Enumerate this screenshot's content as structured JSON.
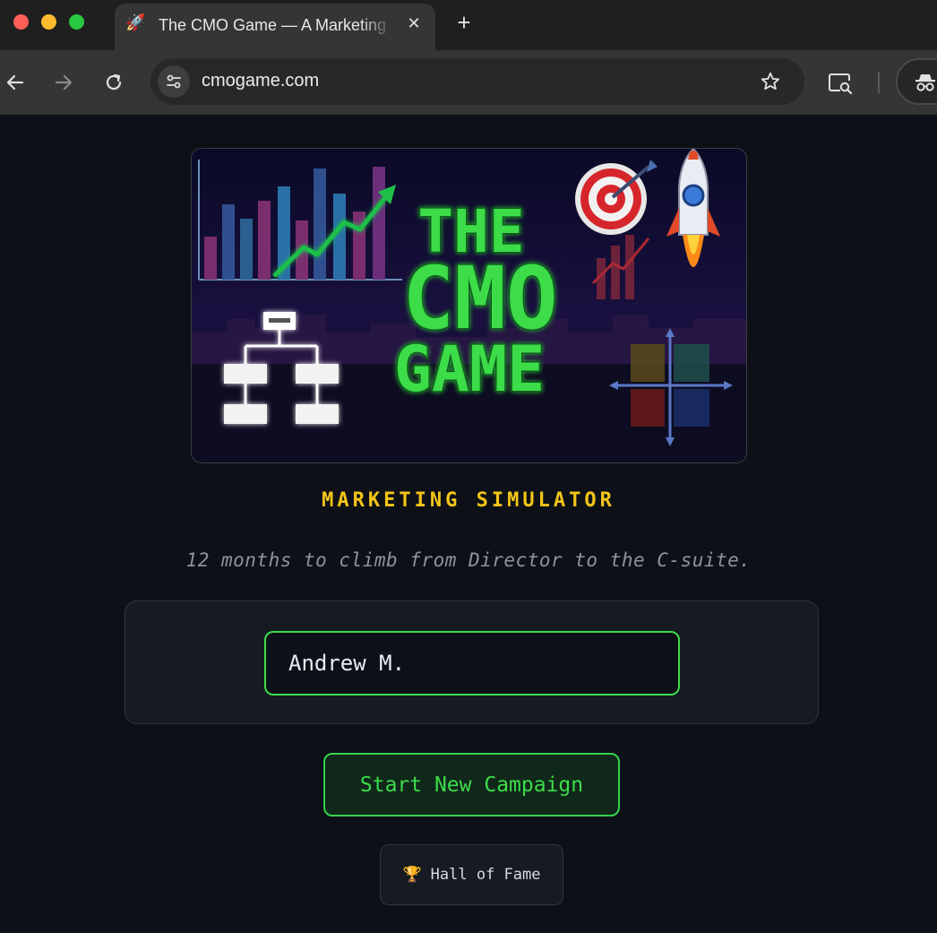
{
  "browser": {
    "tab_title": "The CMO Game — A Marketing Simulator",
    "tab_favicon": "🚀",
    "close_glyph": "✕",
    "new_tab_glyph": "+",
    "url": "cmogame.com",
    "traffic_lights": [
      "#ff5f57",
      "#febc2e",
      "#28c840"
    ]
  },
  "hero": {
    "title_lines": [
      "THE",
      "CMO",
      "GAME"
    ],
    "title_color": "#3ddc4a"
  },
  "main": {
    "subtitle": "MARKETING SIMULATOR",
    "tagline": "12 months to climb from Director to the C-suite.",
    "name_input_value": "Andrew M.",
    "start_button_label": "Start New Campaign",
    "hall_of_fame_icon": "🏆",
    "hall_of_fame_label": "Hall of Fame"
  },
  "colors": {
    "background": "#0d1117",
    "accent_green": "#3ddc4a",
    "accent_yellow": "#f5c518"
  }
}
